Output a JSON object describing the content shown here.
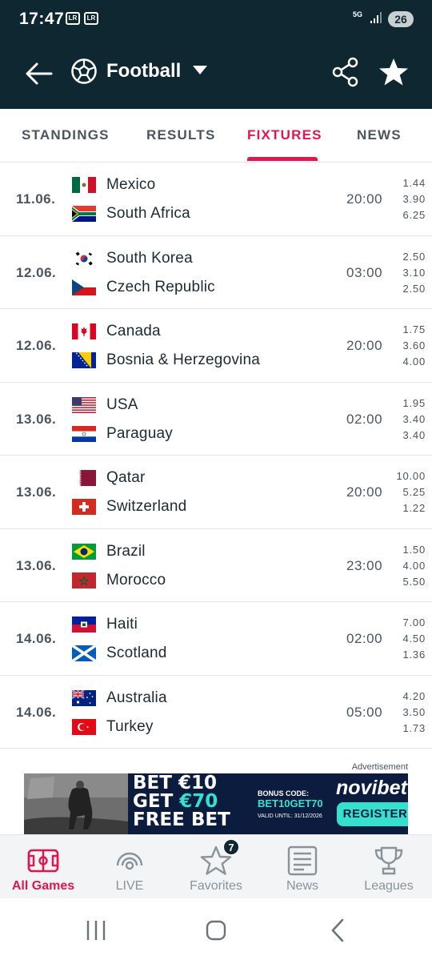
{
  "status_bar": {
    "time": "17:47",
    "notif_icons": [
      "LR",
      "LR"
    ],
    "network": "5G",
    "battery": "26"
  },
  "app_bar": {
    "title": "Football",
    "icons": [
      "back-arrow-icon",
      "football-icon",
      "dropdown-caret-icon",
      "share-icon",
      "star-icon"
    ]
  },
  "tabs": [
    {
      "label": "STANDINGS",
      "active": false
    },
    {
      "label": "RESULTS",
      "active": false
    },
    {
      "label": "FIXTURES",
      "active": true
    },
    {
      "label": "NEWS",
      "active": false
    }
  ],
  "fixtures": [
    {
      "date": "11.06.",
      "home": "Mexico",
      "away": "South Africa",
      "time": "20:00",
      "odds": [
        "1.44",
        "3.90",
        "6.25"
      ]
    },
    {
      "date": "12.06.",
      "home": "South Korea",
      "away": "Czech Republic",
      "time": "03:00",
      "odds": [
        "2.50",
        "3.10",
        "2.50"
      ]
    },
    {
      "date": "12.06.",
      "home": "Canada",
      "away": "Bosnia & Herzegovina",
      "time": "20:00",
      "odds": [
        "1.75",
        "3.60",
        "4.00"
      ]
    },
    {
      "date": "13.06.",
      "home": "USA",
      "away": "Paraguay",
      "time": "02:00",
      "odds": [
        "1.95",
        "3.40",
        "3.40"
      ]
    },
    {
      "date": "13.06.",
      "home": "Qatar",
      "away": "Switzerland",
      "time": "20:00",
      "odds": [
        "10.00",
        "5.25",
        "1.22"
      ]
    },
    {
      "date": "13.06.",
      "home": "Brazil",
      "away": "Morocco",
      "time": "23:00",
      "odds": [
        "1.50",
        "4.00",
        "5.50"
      ]
    },
    {
      "date": "14.06.",
      "home": "Haiti",
      "away": "Scotland",
      "time": "02:00",
      "odds": [
        "7.00",
        "4.50",
        "1.36"
      ]
    },
    {
      "date": "14.06.",
      "home": "Australia",
      "away": "Turkey",
      "time": "05:00",
      "odds": [
        "4.20",
        "3.50",
        "1.73"
      ]
    }
  ],
  "ad": {
    "label": "Advertisement",
    "line1": "BET €10",
    "line2_pre": "GET ",
    "line2_amount": "€70",
    "line3": "FREE BET",
    "promo_label": "BONUS CODE:",
    "promo_code": "BET10GET70",
    "promo_valid": "VALID UNTIL: 31/12/2026",
    "brand": "novibet",
    "cta": "REGISTER"
  },
  "bottom_nav": [
    {
      "label": "All Games",
      "icon": "pitch-icon",
      "active": true
    },
    {
      "label": "LIVE",
      "icon": "live-icon",
      "active": false
    },
    {
      "label": "Favorites",
      "icon": "star-outline-icon",
      "active": false,
      "badge": "7"
    },
    {
      "label": "News",
      "icon": "newspaper-icon",
      "active": false
    },
    {
      "label": "Leagues",
      "icon": "trophy-icon",
      "active": false
    }
  ],
  "colors": {
    "header_bg": "#0f2730",
    "accent": "#e2154e",
    "ad_bg": "#0c1c3e",
    "ad_highlight": "#35e0cf"
  }
}
